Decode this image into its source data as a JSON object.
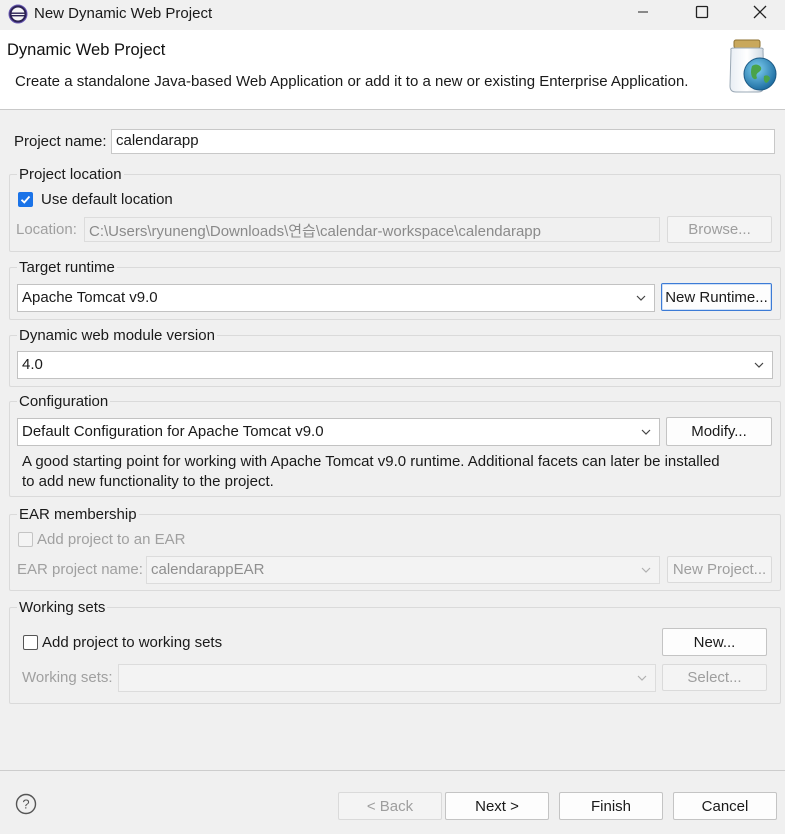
{
  "window": {
    "title": "New Dynamic Web Project",
    "minimize_icon": "minimize-icon",
    "maximize_icon": "maximize-icon",
    "close_icon": "close-icon"
  },
  "banner": {
    "title": "Dynamic Web Project",
    "description": "Create a standalone Java-based Web Application or add it to a new or existing Enterprise Application.",
    "image_icon": "web-project-jar-globe-icon"
  },
  "project_name": {
    "label": "Project name:",
    "value": "calendarapp"
  },
  "project_location": {
    "group_label": "Project location",
    "use_default_label": "Use default location",
    "use_default_checked": true,
    "location_label": "Location:",
    "location_value": "C:\\Users\\ryuneng\\Downloads\\연습\\calendar-workspace\\calendarapp",
    "browse_label": "Browse..."
  },
  "target_runtime": {
    "group_label": "Target runtime",
    "selected": "Apache Tomcat v9.0",
    "new_runtime_label": "New Runtime..."
  },
  "module_version": {
    "group_label": "Dynamic web module version",
    "selected": "4.0"
  },
  "configuration": {
    "group_label": "Configuration",
    "selected": "Default Configuration for Apache Tomcat v9.0",
    "modify_label": "Modify...",
    "description_line1": "A good starting point for working with Apache Tomcat v9.0 runtime. Additional facets can later be installed",
    "description_line2": "to add new functionality to the project."
  },
  "ear": {
    "group_label": "EAR membership",
    "add_label": "Add project to an EAR",
    "add_checked": false,
    "name_label": "EAR project name:",
    "name_value": "calendarappEAR",
    "new_project_label": "New Project..."
  },
  "working_sets": {
    "group_label": "Working sets",
    "add_label": "Add project to working sets",
    "add_checked": false,
    "new_label": "New...",
    "sets_label": "Working sets:",
    "sets_value": "",
    "select_label": "Select..."
  },
  "footer": {
    "help_icon": "help-icon",
    "back_label": "< Back",
    "next_label": "Next >",
    "finish_label": "Finish",
    "cancel_label": "Cancel"
  },
  "colors": {
    "accent": "#1a73e8",
    "focus_border": "#3c7bd6",
    "background": "#f0f0f0"
  }
}
